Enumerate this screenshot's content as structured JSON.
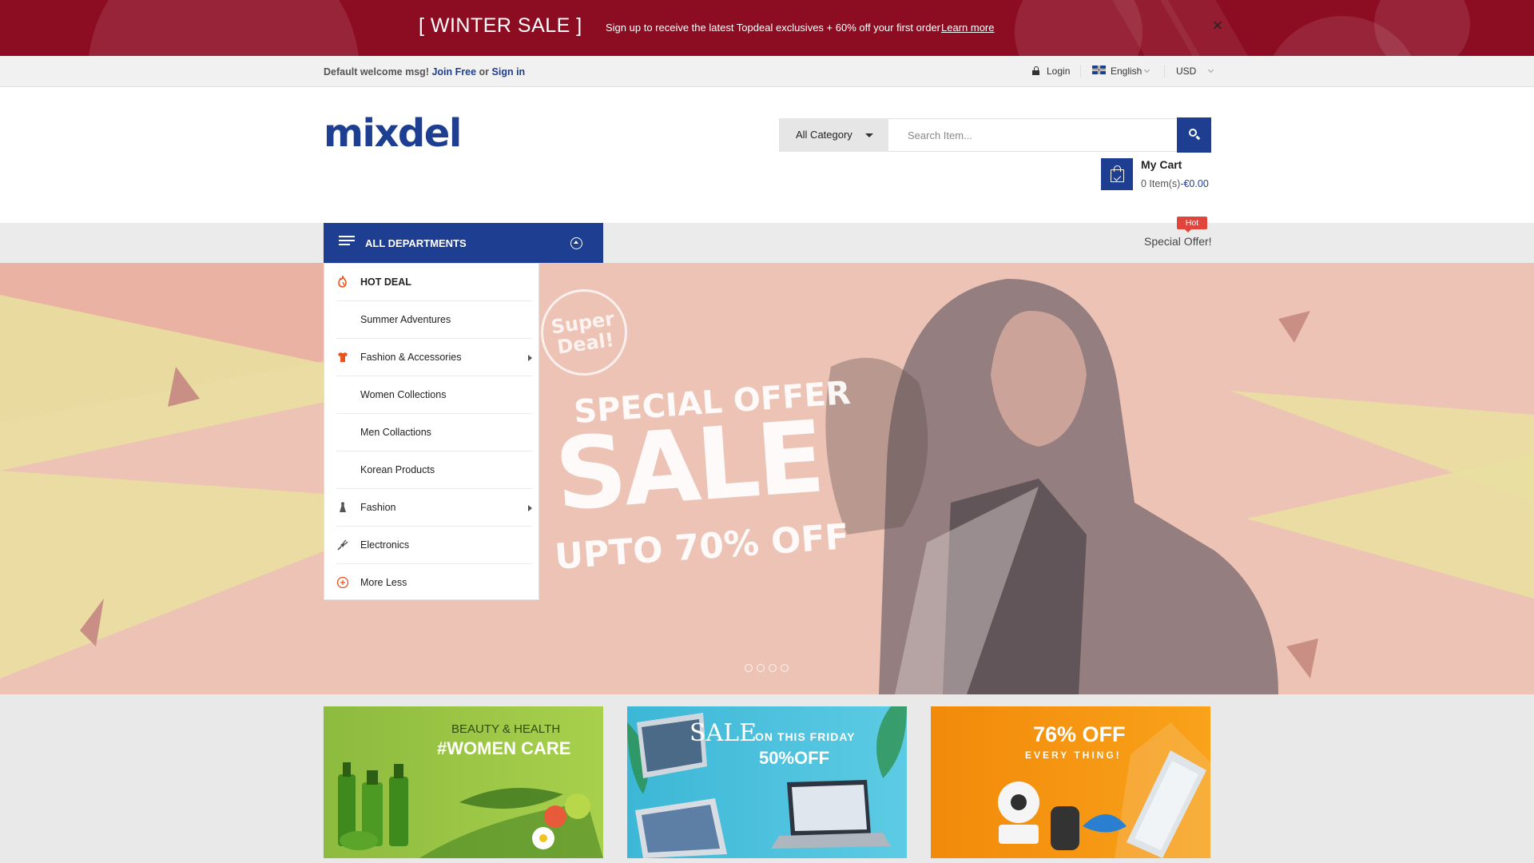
{
  "promo": {
    "title": "[ WINTER SALE ]",
    "text": "Sign up to receive the latest Topdeal exclusives + 60% off your first order",
    "link": "Learn more",
    "bg_color": "#8c0c22"
  },
  "topbar": {
    "welcome": "Default welcome msg!",
    "join": "Join Free",
    "or": "or",
    "signin": "Sign in",
    "login": "Login",
    "language": "English",
    "currency": "USD"
  },
  "header": {
    "logo": "mixdel",
    "category_label": "All Category",
    "search_placeholder": "Search Item...",
    "cart_title": "My Cart",
    "cart_items": "0 Item(s)",
    "cart_dash": "-",
    "cart_total": "€0.00",
    "brand_color": "#1e3f91"
  },
  "nav": {
    "all_departments": "ALL DEPARTMENTS",
    "hot_badge": "Hot",
    "special_offer": "Special Offer!"
  },
  "menu": [
    {
      "label": "HOT DEAL",
      "icon": "fire-icon",
      "bold": true,
      "submenu": false
    },
    {
      "label": "Summer Adventures",
      "icon": "",
      "bold": false,
      "submenu": false
    },
    {
      "label": "Fashion & Accessories",
      "icon": "tshirt-icon",
      "bold": false,
      "submenu": true
    },
    {
      "label": "Women Collections",
      "icon": "",
      "bold": false,
      "submenu": false
    },
    {
      "label": "Men Collactions",
      "icon": "",
      "bold": false,
      "submenu": false
    },
    {
      "label": "Korean Products",
      "icon": "",
      "bold": false,
      "submenu": false
    },
    {
      "label": "Fashion",
      "icon": "dress-icon",
      "bold": false,
      "submenu": true
    },
    {
      "label": "Electronics",
      "icon": "plug-icon",
      "bold": false,
      "submenu": false
    },
    {
      "label": "More Less",
      "icon": "plus-circle-icon",
      "bold": false,
      "submenu": false
    }
  ],
  "hero": {
    "seal_line1": "Super",
    "seal_line2": "Deal!",
    "offer": "SPECIAL OFFER",
    "sale": "SALE",
    "upto": "UPTO 70% OFF",
    "slide_count": 4
  },
  "banners": [
    {
      "line1": "BEAUTY & HEALTH",
      "line2": "#WOMEN CARE"
    },
    {
      "line1": "SALE",
      "line1b": "ON THIS FRIDAY",
      "line2": "50%OFF"
    },
    {
      "line1": "76% OFF",
      "line2": "EVERY THING!"
    }
  ]
}
